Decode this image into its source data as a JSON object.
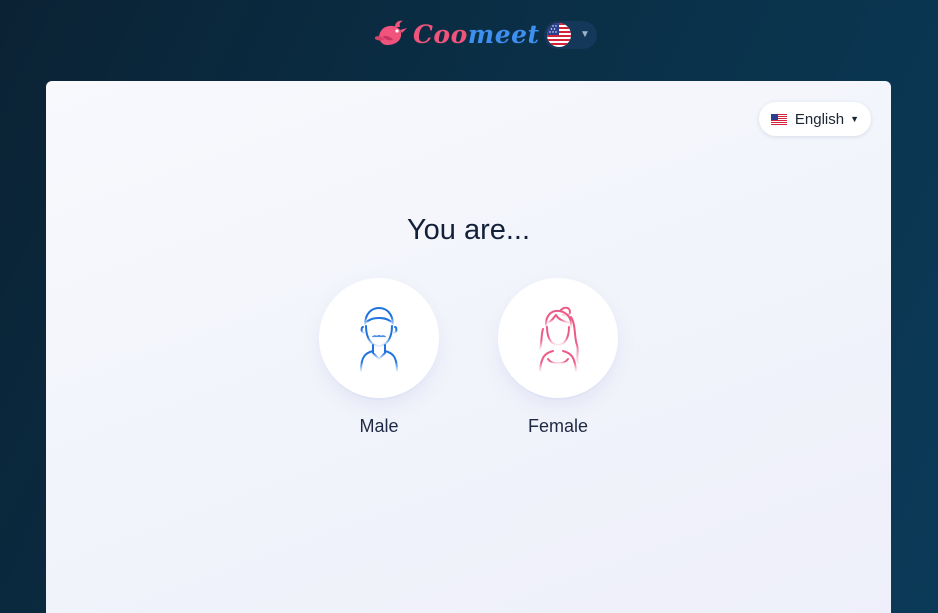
{
  "header": {
    "brand_part1": "Coo",
    "brand_part2": "meet",
    "language_flag_icon": "us-flag-icon",
    "language_chevron_icon": "chevron-down-icon"
  },
  "card": {
    "language_selector": {
      "flag_icon": "us-flag-icon",
      "label": "English",
      "chevron_icon": "chevron-down-icon"
    },
    "title": "You are...",
    "options": [
      {
        "label": "Male",
        "icon": "male-avatar-icon",
        "color": "#1f73e0"
      },
      {
        "label": "Female",
        "icon": "female-avatar-icon",
        "color": "#ec5a86"
      }
    ]
  },
  "colors": {
    "brand_pink": "#f0537b",
    "brand_blue": "#3d8ff0",
    "background_dark": "#0a2f46"
  }
}
